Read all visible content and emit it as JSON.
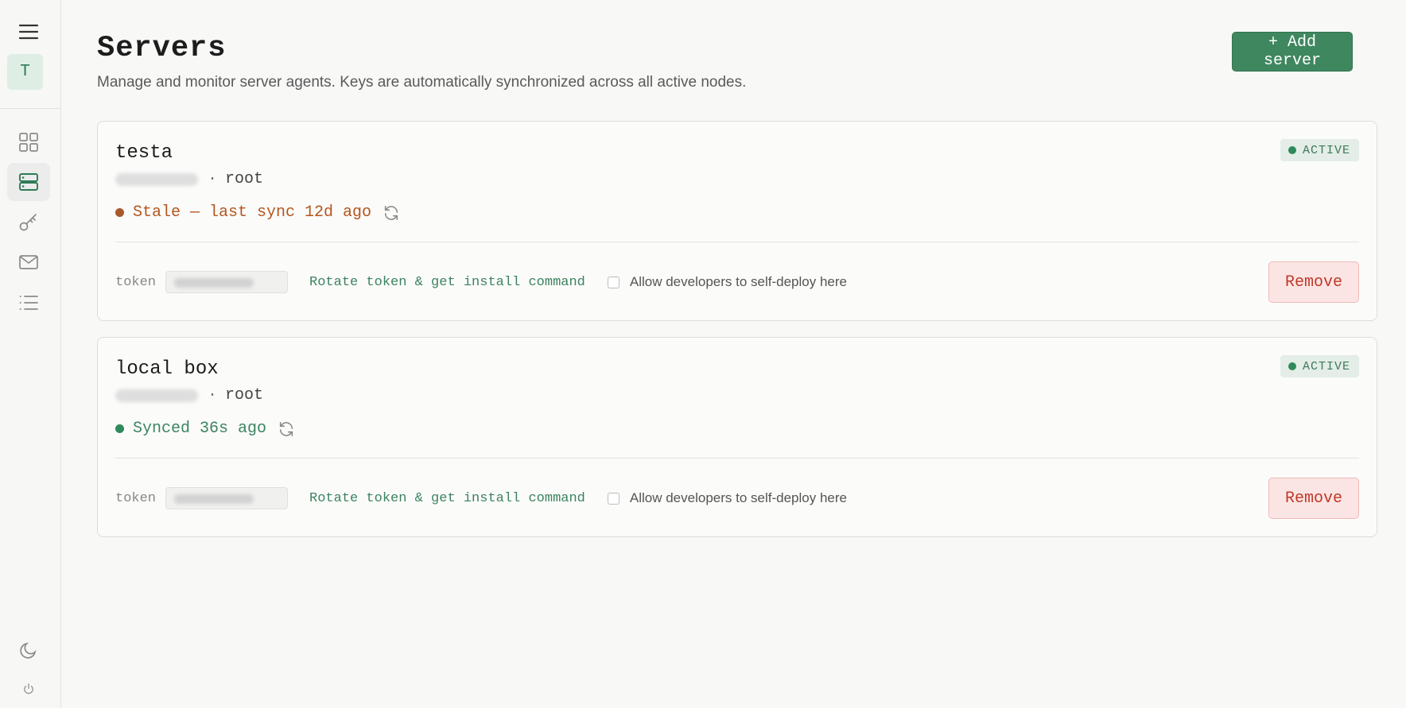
{
  "sidebar": {
    "avatar_letter": "T",
    "nav": [
      {
        "icon": "grid-icon",
        "label": "dashboard"
      },
      {
        "icon": "server-icon",
        "label": "servers",
        "active": true
      },
      {
        "icon": "key-icon",
        "label": "keys"
      },
      {
        "icon": "mail-icon",
        "label": "mail"
      },
      {
        "icon": "list-icon",
        "label": "logs"
      }
    ],
    "bottom": [
      {
        "icon": "moon-icon"
      },
      {
        "icon": "power-icon"
      }
    ]
  },
  "header": {
    "title": "Servers",
    "subtitle": "Manage and monitor server agents. Keys are automatically synchronized across all active nodes.",
    "add_button": "+ Add server"
  },
  "servers": [
    {
      "name": "testa",
      "user": "root",
      "separator": "·",
      "status_badge": "ACTIVE",
      "sync_text": "Stale — last sync 12d ago",
      "sync_state": "stale",
      "token_label": "token",
      "rotate_link": "Rotate token & get install command",
      "self_deploy_label": "Allow developers to self-deploy here",
      "self_deploy_checked": false,
      "remove_button": "Remove"
    },
    {
      "name": "local box",
      "user": "root",
      "separator": "·",
      "status_badge": "ACTIVE",
      "sync_text": "Synced 36s ago",
      "sync_state": "synced",
      "token_label": "token",
      "rotate_link": "Rotate token & get install command",
      "self_deploy_label": "Allow developers to self-deploy here",
      "self_deploy_checked": false,
      "remove_button": "Remove"
    }
  ],
  "colors": {
    "accent": "#3f875f",
    "stale": "#b5561f",
    "stale_dot": "#a9582c",
    "synced": "#3c8560",
    "synced_dot": "#2f8a5a",
    "danger": "#c0392b"
  }
}
